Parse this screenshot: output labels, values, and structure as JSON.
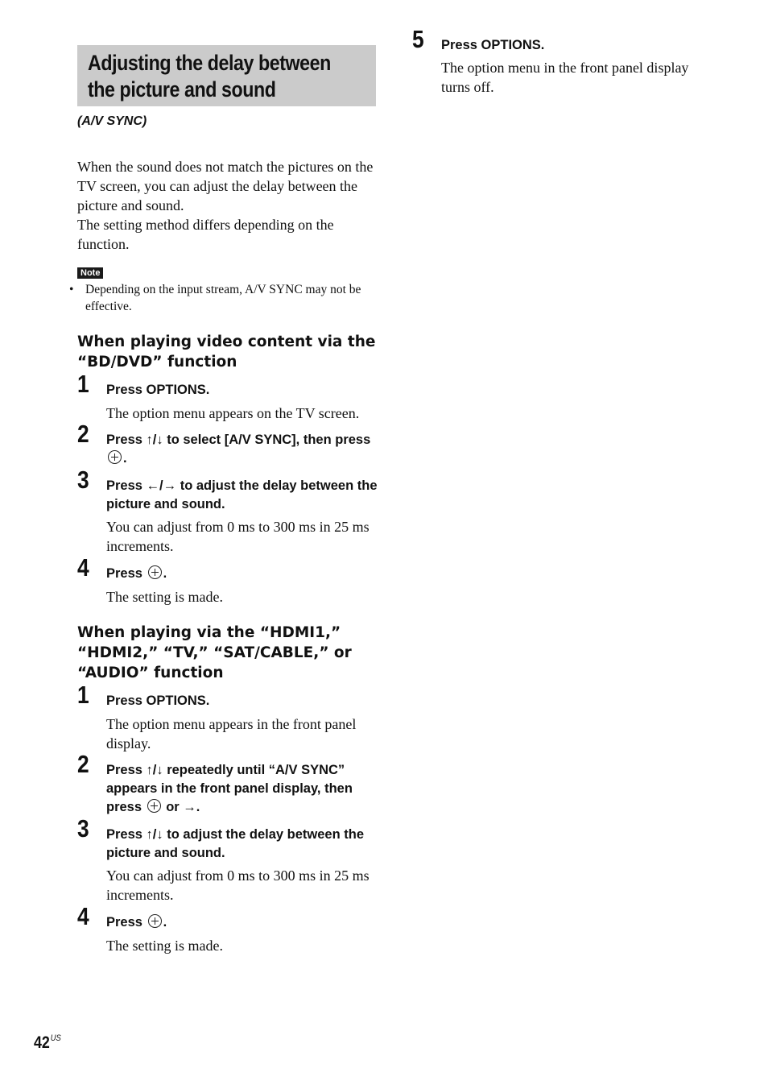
{
  "title": "Adjusting the delay between the picture and sound",
  "title_lines": [
    "Adjusting the delay between",
    "the picture and sound"
  ],
  "subtitle": "(A/V SYNC)",
  "intro": [
    "When the sound does not match the pictures on the TV screen, you can adjust the delay between the picture and sound.",
    "The setting method differs depending on the function."
  ],
  "note": {
    "label": "Note",
    "bullet": "•",
    "items": [
      "Depending on the input stream, A/V SYNC may not be effective."
    ]
  },
  "sections": [
    {
      "heading": "When playing video content via the “BD/DVD” function",
      "steps": [
        {
          "number": "1",
          "instruction": "Press OPTIONS.",
          "description": "The option menu appears on the TV screen."
        },
        {
          "number": "2",
          "instruction_pre": "Press ↑/↓ to select [A/V SYNC], then press",
          "instruction_post": ".",
          "icon": "enter-button-icon"
        },
        {
          "number": "3",
          "instruction": "Press ←/→ to adjust the delay between the picture and sound.",
          "description": "You can adjust from 0 ms to 300 ms in 25 ms increments."
        },
        {
          "number": "4",
          "instruction_pre": "Press",
          "instruction_post": ".",
          "icon": "enter-button-icon",
          "description": "The setting is made."
        }
      ]
    },
    {
      "heading": "When playing via the “HDMI1,” “HDMI2,” “TV,” “SAT/CABLE,” or “AUDIO” function",
      "steps": [
        {
          "number": "1",
          "instruction": "Press OPTIONS.",
          "description": "The option menu appears in the front panel display."
        },
        {
          "number": "2",
          "instruction_pre": "Press ↑/↓ repeatedly until “A/V SYNC” appears in the front panel display, then press",
          "instruction_post": "or →.",
          "icon": "enter-button-icon"
        },
        {
          "number": "3",
          "instruction": "Press ↑/↓ to adjust the delay between the picture and sound.",
          "description": "You can adjust from 0 ms to 300 ms in 25 ms increments."
        },
        {
          "number": "4",
          "instruction_pre": "Press",
          "instruction_post": ".",
          "icon": "enter-button-icon",
          "description": "The setting is made."
        },
        {
          "number": "5",
          "instruction": "Press OPTIONS.",
          "description": "The option menu in the front panel display turns off."
        }
      ]
    }
  ],
  "footer": {
    "page_number": "42",
    "region": "US"
  }
}
